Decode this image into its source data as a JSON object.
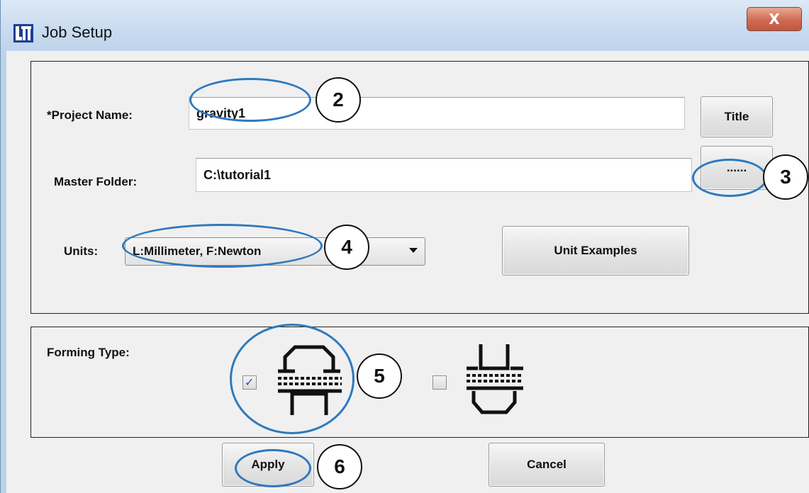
{
  "window": {
    "title": "Job Setup",
    "close_glyph": "X",
    "app_icon": "lsts-logo-icon"
  },
  "project": {
    "label": "*Project Name:",
    "value": "gravity1",
    "title_button": "Title"
  },
  "master_folder": {
    "label": "Master Folder:",
    "value": "C:\\tutorial1",
    "browse_button": "......"
  },
  "units": {
    "label": "Units:",
    "selected": "L:Millimeter, F:Newton",
    "examples_button": "Unit Examples"
  },
  "forming_type": {
    "label": "Forming Type:",
    "options": [
      {
        "icon": "forming-type-1-icon",
        "checked": true,
        "check_glyph": "✓"
      },
      {
        "icon": "forming-type-2-icon",
        "checked": false
      }
    ]
  },
  "actions": {
    "apply": "Apply",
    "cancel": "Cancel"
  },
  "callouts": [
    "2",
    "3",
    "4",
    "5",
    "6"
  ],
  "colors": {
    "annotation_ellipse": "#2f79bd",
    "titlebar": "#c6d9ee",
    "close_button": "#cf6a52"
  }
}
